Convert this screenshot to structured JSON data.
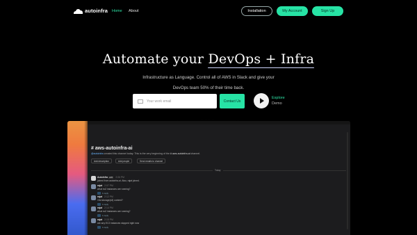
{
  "nav": {
    "brand": "autoinfra",
    "links": [
      "Home",
      "About"
    ],
    "buttons": {
      "installation": "Installation",
      "my_account": "My Account",
      "sign_up": "Sign Up"
    }
  },
  "hero": {
    "title_prefix": "Automate your",
    "title_highlight": "DevOps + Infra",
    "subtitle_line1": "Infrastructure as Language. Control all of AWS in Slack and give your",
    "subtitle_line2": "DevOps team 50% of their time back.",
    "email_placeholder": "Your work email",
    "contact_button": "Contact Us",
    "explore_line1": "Explore",
    "explore_line2": "Demo"
  },
  "slack_preview": {
    "channel": "# aws-autoinfra-ai",
    "channel_desc_user": "@autoinfra",
    "channel_desc_text": " created this channel today. This is the very beginning of the ",
    "channel_desc_channel": "# aws-autoinfra-ai",
    "channel_desc_end": " channel.",
    "actions": [
      "Add description",
      "Add people",
      "Send emails to channel"
    ],
    "date_divider": "Today",
    "messages": [
      {
        "name": "AutoInfra",
        "tag": "APP",
        "time": "2:06 PM",
        "text": "joined from autoinfra-ai. Also, rajat joined."
      },
      {
        "name": "rajat",
        "time": "2:07 PM",
        "text": "what ec2 instances are running?"
      },
      {
        "name": "rajat",
        "time": "2:12 PM",
        "text": "i list storage(s3) content?"
      },
      {
        "name": "rajat",
        "time": "2:14 PM",
        "text": "what ec2 instances are running?"
      },
      {
        "name": "rajat",
        "time": "2:15 PM",
        "text": "are any EC2 instances stopped right now"
      }
    ],
    "reply_text": "1 reply"
  },
  "colors": {
    "accent": "#27e3a5",
    "background": "#000000",
    "window": "#1c1c1e"
  }
}
